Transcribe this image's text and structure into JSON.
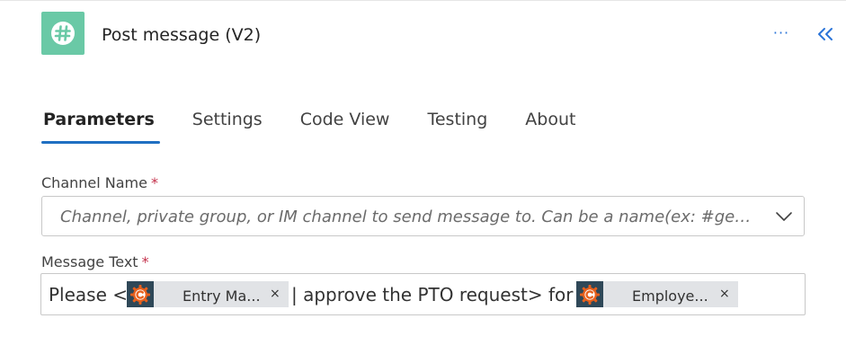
{
  "header": {
    "title": "Post message (V2)",
    "more_label": "···",
    "app_icon": "slack-hash-icon",
    "collapse_icon": "double-chevron-left-icon"
  },
  "tabs": [
    {
      "label": "Parameters",
      "active": true
    },
    {
      "label": "Settings",
      "active": false
    },
    {
      "label": "Code View",
      "active": false
    },
    {
      "label": "Testing",
      "active": false
    },
    {
      "label": "About",
      "active": false
    }
  ],
  "channel": {
    "label": "Channel Name",
    "required_mark": "*",
    "placeholder": "Channel, private group, or IM channel to send message to. Can be a name(ex: #gen...",
    "icon": "chevron-down-icon"
  },
  "message": {
    "label": "Message Text",
    "required_mark": "*",
    "segments": {
      "text1": "Please <",
      "token1": {
        "label": "Entry Ma...",
        "remove": "×",
        "icon": "connector-c-icon"
      },
      "text2": "| approve the PTO request> for",
      "token2": {
        "label": "Employe...",
        "remove": "×",
        "icon": "connector-c-icon"
      }
    }
  },
  "colors": {
    "accent": "#1f6fc2",
    "app_icon_bg": "#6ac9a6",
    "token_bg": "#e1e3e6",
    "token_icon_bg": "#2f4858",
    "token_icon_fg": "#e8601c",
    "required": "#c4314b"
  }
}
